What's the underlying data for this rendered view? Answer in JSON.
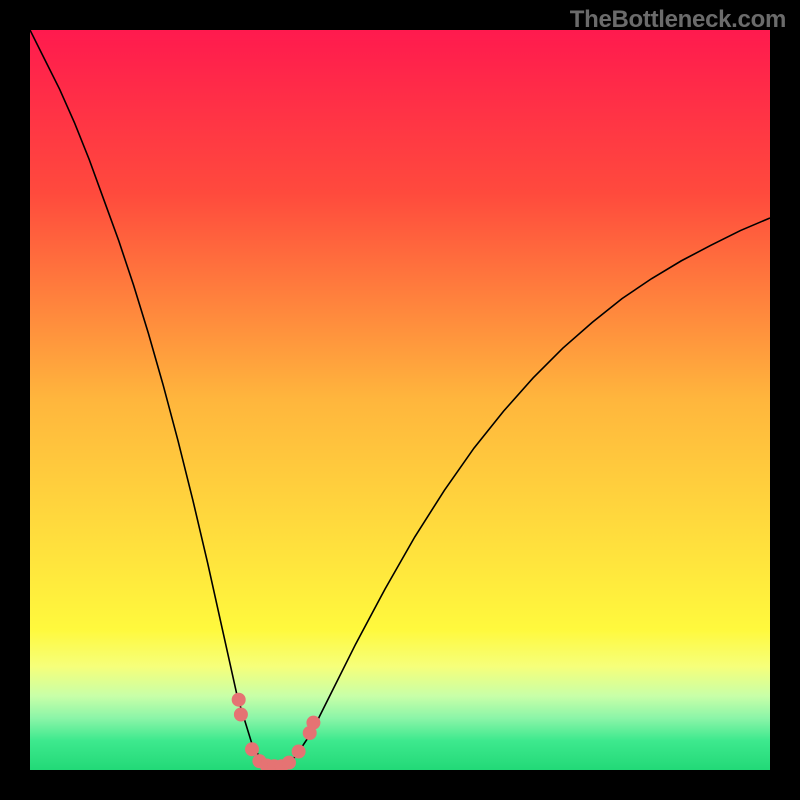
{
  "watermark": "TheBottleneck.com",
  "chart_data": {
    "type": "line",
    "title": "",
    "xlabel": "",
    "ylabel": "",
    "xlim": [
      0,
      100
    ],
    "ylim": [
      0,
      100
    ],
    "grid": false,
    "legend": false,
    "gradient_stops": [
      {
        "pct": 0,
        "color": "#ff1a4e"
      },
      {
        "pct": 22,
        "color": "#ff4a3d"
      },
      {
        "pct": 50,
        "color": "#ffb63d"
      },
      {
        "pct": 72,
        "color": "#ffe53d"
      },
      {
        "pct": 81,
        "color": "#fff93d"
      },
      {
        "pct": 86,
        "color": "#f6ff7a"
      },
      {
        "pct": 90,
        "color": "#c8ffa8"
      },
      {
        "pct": 93,
        "color": "#8bf5a8"
      },
      {
        "pct": 96,
        "color": "#3ee98e"
      },
      {
        "pct": 100,
        "color": "#22d977"
      }
    ],
    "series": [
      {
        "name": "bottleneck-curve",
        "color": "#000000",
        "width": 1.6,
        "x": [
          0,
          2,
          4,
          6,
          8,
          10,
          12,
          14,
          16,
          18,
          20,
          22,
          24,
          26,
          28,
          30,
          31,
          32,
          33,
          34,
          35,
          36,
          38,
          40,
          44,
          48,
          52,
          56,
          60,
          64,
          68,
          72,
          76,
          80,
          84,
          88,
          92,
          96,
          100
        ],
        "y": [
          100,
          96,
          92,
          87.5,
          82.5,
          77,
          71.5,
          65.5,
          59,
          52,
          44.5,
          36.5,
          28,
          19,
          10,
          3.5,
          1.8,
          0.8,
          0.5,
          0.5,
          0.9,
          2.0,
          5.0,
          9.0,
          17.0,
          24.5,
          31.5,
          37.8,
          43.5,
          48.5,
          53.0,
          57.0,
          60.5,
          63.7,
          66.4,
          68.8,
          70.9,
          72.9,
          74.6
        ]
      }
    ],
    "markers": {
      "name": "highlight-dots",
      "color": "#e57373",
      "radius": 7,
      "points": [
        {
          "x": 28.2,
          "y": 9.5
        },
        {
          "x": 28.5,
          "y": 7.5
        },
        {
          "x": 30.0,
          "y": 2.8
        },
        {
          "x": 31.0,
          "y": 1.2
        },
        {
          "x": 32.0,
          "y": 0.6
        },
        {
          "x": 33.0,
          "y": 0.5
        },
        {
          "x": 34.0,
          "y": 0.5
        },
        {
          "x": 35.0,
          "y": 1.0
        },
        {
          "x": 36.3,
          "y": 2.5
        },
        {
          "x": 37.8,
          "y": 5.0
        },
        {
          "x": 38.3,
          "y": 6.4
        }
      ]
    }
  }
}
